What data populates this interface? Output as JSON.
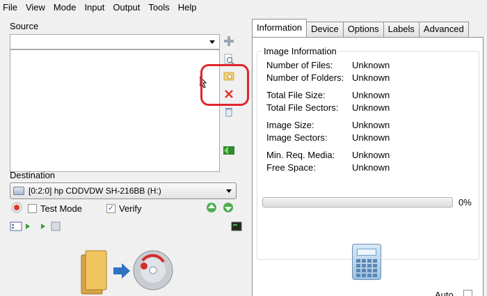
{
  "menu": [
    "File",
    "View",
    "Mode",
    "Input",
    "Output",
    "Tools",
    "Help"
  ],
  "source": {
    "label": "Source",
    "value": ""
  },
  "destination": {
    "label": "Destination",
    "drive": "[0:2:0] hp CDDVDW SH-216BB (H:)",
    "test_mode_label": "Test Mode",
    "test_mode_checked": false,
    "verify_label": "Verify",
    "verify_checked": true
  },
  "tabs": [
    "Information",
    "Device",
    "Options",
    "Labels",
    "Advanced"
  ],
  "active_tab": "Information",
  "info": {
    "caption": "Image Information",
    "rows": [
      {
        "label": "Number of Files:",
        "value": "Unknown"
      },
      {
        "label": "Number of Folders:",
        "value": "Unknown"
      },
      {
        "label": "Total File Size:",
        "value": "Unknown"
      },
      {
        "label": "Total File Sectors:",
        "value": "Unknown"
      },
      {
        "label": "Image Size:",
        "value": "Unknown"
      },
      {
        "label": "Image Sectors:",
        "value": "Unknown"
      },
      {
        "label": "Min. Req. Media:",
        "value": "Unknown"
      },
      {
        "label": "Free Space:",
        "value": "Unknown"
      }
    ],
    "progress_percent": 0,
    "progress_label": "0%"
  },
  "auto": {
    "label": "Auto",
    "checked": false
  },
  "colors": {
    "highlight": "#e0262b",
    "accent": "#2a5db0"
  }
}
